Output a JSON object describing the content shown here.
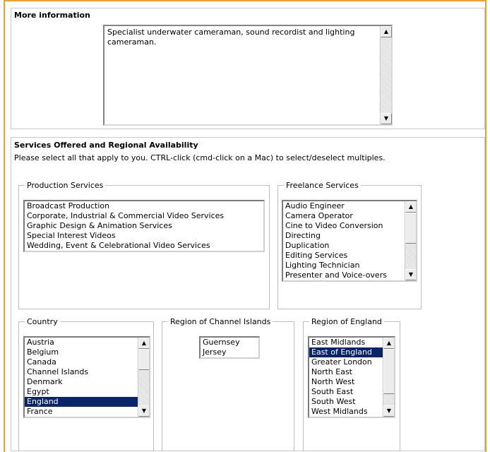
{
  "more_info": {
    "title": "More information",
    "text": "Specialist underwater cameraman, sound recordist and lighting cameraman."
  },
  "services": {
    "title": "Services Offered and Regional Availability",
    "instructions": "Please select all that apply to you. CTRL-click (cmd-click on a Mac) to select/deselect multiples.",
    "production": {
      "legend": "Production Services",
      "options": [
        "Broadcast Production",
        "Corporate, Industrial & Commercial Video Services",
        "Graphic Design & Animation Services",
        "Special Interest Videos",
        "Wedding, Event & Celebrational Video Services"
      ]
    },
    "freelance": {
      "legend": "Freelance Services",
      "options": [
        "Audio Engineer",
        "Camera Operator",
        "Cine to Video Conversion",
        "Directing",
        "Duplication",
        "Editing Services",
        "Lighting Technician",
        "Presenter and Voice-overs"
      ]
    },
    "country": {
      "legend": "Country",
      "options": [
        "Austria",
        "Belgium",
        "Canada",
        "Channel Islands",
        "Denmark",
        "Egypt",
        "England",
        "France"
      ],
      "selected": "England"
    },
    "channel_islands": {
      "legend": "Region of Channel Islands",
      "options": [
        "Guernsey",
        "Jersey"
      ]
    },
    "england": {
      "legend": "Region of England",
      "options": [
        "East Midlands",
        "East of England",
        "Greater London",
        "North East",
        "North West",
        "South East",
        "South West",
        "West Midlands"
      ],
      "selected": "East of England"
    }
  },
  "icons": {
    "scroll_up": "scroll-up-arrow",
    "scroll_down": "scroll-down-arrow"
  },
  "colors": {
    "frame_border": "#f0a030",
    "selection": "#0a246a"
  }
}
